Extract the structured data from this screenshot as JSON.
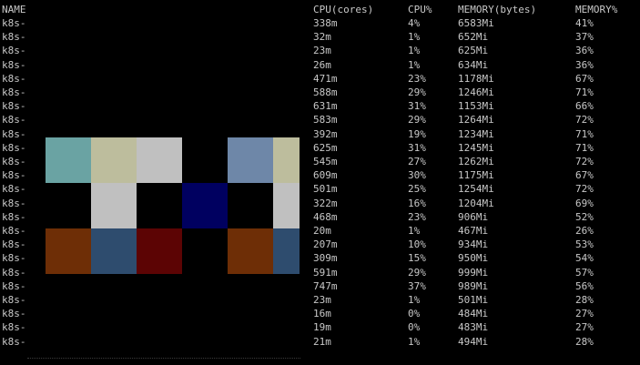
{
  "header": {
    "name": "NAME",
    "cpu_cores": "CPU(cores)",
    "cpu_pct": "CPU%",
    "memory_bytes": "MEMORY(bytes)",
    "memory_pct": "MEMORY%"
  },
  "rows": [
    {
      "name": "k8s-",
      "cpu": "338m",
      "cpu_pct": "4%",
      "mem": "6583Mi",
      "mem_pct": "41%"
    },
    {
      "name": "k8s-",
      "cpu": "32m",
      "cpu_pct": "1%",
      "mem": "652Mi",
      "mem_pct": "37%"
    },
    {
      "name": "k8s-",
      "cpu": "23m",
      "cpu_pct": "1%",
      "mem": "625Mi",
      "mem_pct": "36%"
    },
    {
      "name": "k8s-",
      "cpu": "26m",
      "cpu_pct": "1%",
      "mem": "634Mi",
      "mem_pct": "36%"
    },
    {
      "name": "k8s-",
      "cpu": "471m",
      "cpu_pct": "23%",
      "mem": "1178Mi",
      "mem_pct": "67%"
    },
    {
      "name": "k8s-",
      "cpu": "588m",
      "cpu_pct": "29%",
      "mem": "1246Mi",
      "mem_pct": "71%"
    },
    {
      "name": "k8s-",
      "cpu": "631m",
      "cpu_pct": "31%",
      "mem": "1153Mi",
      "mem_pct": "66%"
    },
    {
      "name": "k8s-",
      "cpu": "583m",
      "cpu_pct": "29%",
      "mem": "1264Mi",
      "mem_pct": "72%"
    },
    {
      "name": "k8s-",
      "cpu": "392m",
      "cpu_pct": "19%",
      "mem": "1234Mi",
      "mem_pct": "71%"
    },
    {
      "name": "k8s-",
      "cpu": "625m",
      "cpu_pct": "31%",
      "mem": "1245Mi",
      "mem_pct": "71%"
    },
    {
      "name": "k8s-",
      "cpu": "545m",
      "cpu_pct": "27%",
      "mem": "1262Mi",
      "mem_pct": "72%"
    },
    {
      "name": "k8s-",
      "cpu": "609m",
      "cpu_pct": "30%",
      "mem": "1175Mi",
      "mem_pct": "67%"
    },
    {
      "name": "k8s-",
      "cpu": "501m",
      "cpu_pct": "25%",
      "mem": "1254Mi",
      "mem_pct": "72%"
    },
    {
      "name": "k8s-",
      "cpu": "322m",
      "cpu_pct": "16%",
      "mem": "1204Mi",
      "mem_pct": "69%"
    },
    {
      "name": "k8s-",
      "cpu": "468m",
      "cpu_pct": "23%",
      "mem": "906Mi",
      "mem_pct": "52%"
    },
    {
      "name": "k8s-",
      "cpu": "20m",
      "cpu_pct": "1%",
      "mem": "467Mi",
      "mem_pct": "26%"
    },
    {
      "name": "k8s-",
      "cpu": "207m",
      "cpu_pct": "10%",
      "mem": "934Mi",
      "mem_pct": "53%"
    },
    {
      "name": "k8s-",
      "cpu": "309m",
      "cpu_pct": "15%",
      "mem": "950Mi",
      "mem_pct": "54%"
    },
    {
      "name": "k8s-",
      "cpu": "591m",
      "cpu_pct": "29%",
      "mem": "999Mi",
      "mem_pct": "57%"
    },
    {
      "name": "k8s-",
      "cpu": "747m",
      "cpu_pct": "37%",
      "mem": "989Mi",
      "mem_pct": "56%"
    },
    {
      "name": "k8s-",
      "cpu": "23m",
      "cpu_pct": "1%",
      "mem": "501Mi",
      "mem_pct": "28%"
    },
    {
      "name": "k8s-",
      "cpu": "16m",
      "cpu_pct": "0%",
      "mem": "484Mi",
      "mem_pct": "27%"
    },
    {
      "name": "k8s-",
      "cpu": "19m",
      "cpu_pct": "0%",
      "mem": "483Mi",
      "mem_pct": "27%"
    },
    {
      "name": "k8s-",
      "cpu": "21m",
      "cpu_pct": "1%",
      "mem": "494Mi",
      "mem_pct": "28%"
    }
  ],
  "colors": {
    "background": "#000000",
    "text": "#c8c8c8",
    "teal": "#6aa3a3",
    "khaki": "#bdbd9d",
    "silver": "#c0c0c0",
    "slate_blue": "#6e87a8",
    "navy": "#000060",
    "rust": "#6e2e06",
    "steel_blue": "#2e4c6e",
    "maroon": "#5c0404"
  }
}
